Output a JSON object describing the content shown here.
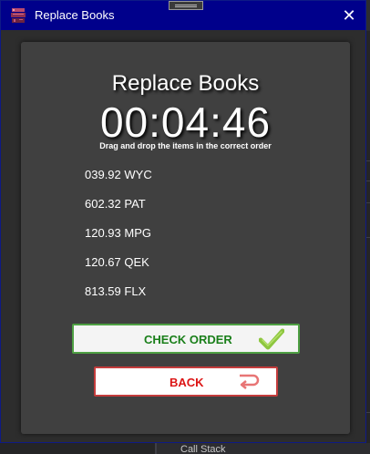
{
  "window": {
    "title": "Replace Books",
    "close_glyph": "✕",
    "app_icon": "books-icon",
    "titlebar_color": "#00008b"
  },
  "game": {
    "title": "Replace Books",
    "timer": "00:04:46",
    "instructions": "Drag and drop the items in the correct order",
    "items": [
      {
        "label": "039.92 WYC"
      },
      {
        "label": "602.32 PAT"
      },
      {
        "label": "120.93 MPG"
      },
      {
        "label": "120.67 QEK"
      },
      {
        "label": "813.59 FLX"
      }
    ]
  },
  "buttons": {
    "check_label": "CHECK ORDER",
    "check_icon": "checkmark-icon",
    "check_color": "#1a7f1a",
    "back_label": "BACK",
    "back_icon": "return-arrow-icon",
    "back_color": "#dc1414"
  },
  "background": {
    "call_stack_label": "Call Stack"
  }
}
